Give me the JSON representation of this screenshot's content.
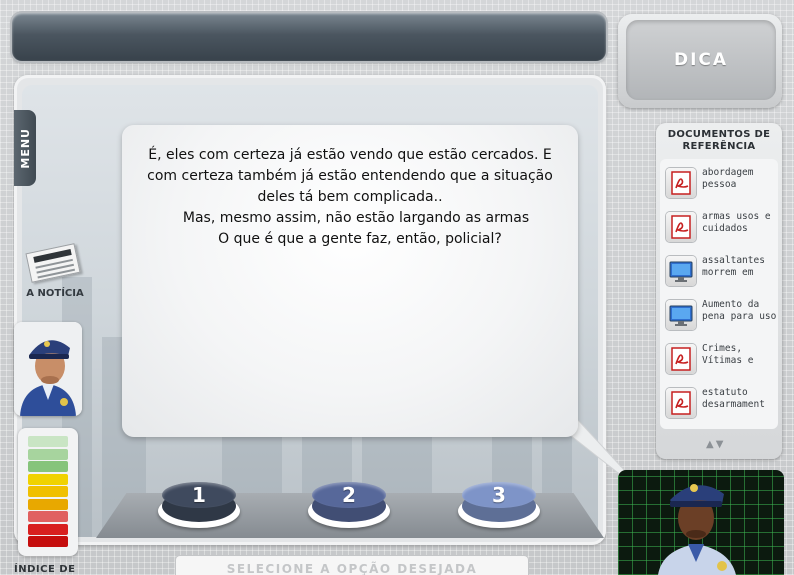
{
  "dica": {
    "label": "DICA"
  },
  "menu": {
    "label": "MENU"
  },
  "noticia": {
    "label": "A NOTÍCIA"
  },
  "indice": {
    "label": "ÍNDICE DE"
  },
  "dialogue": {
    "lines": [
      "É, eles com certeza já estão vendo que estão cercados. E",
      "com certeza também já estão entendendo que a situação",
      "deles tá bem complicada..",
      "Mas, mesmo assim, não estão largando as armas",
      "O que é que a gente faz, então, policial?"
    ]
  },
  "options": [
    {
      "label": "1",
      "color": "#3f4a5e"
    },
    {
      "label": "2",
      "color": "#57689a"
    },
    {
      "label": "3",
      "color": "#7e94c8"
    }
  ],
  "select_prompt": "SELECIONE A OPÇÃO DESEJADA",
  "docs": {
    "title_line1": "DOCUMENTOS DE",
    "title_line2": "REFERÊNCIA",
    "items": [
      {
        "label_line1": "abordagem",
        "label_line2": "pessoa",
        "icon": "pdf-icon"
      },
      {
        "label_line1": "armas usos e",
        "label_line2": "cuidados",
        "icon": "pdf-icon"
      },
      {
        "label_line1": "assaltantes",
        "label_line2": "morrem em",
        "icon": "monitor-icon"
      },
      {
        "label_line1": "Aumento da",
        "label_line2": "pena para uso",
        "icon": "monitor-icon"
      },
      {
        "label_line1": "Crimes,",
        "label_line2": "Vítimas e",
        "icon": "pdf-icon"
      },
      {
        "label_line1": "estatuto",
        "label_line2": "desarmament",
        "icon": "pdf-icon"
      }
    ],
    "scroll_arrows": "▲▼"
  },
  "meter": {
    "colors": [
      "#c9e5c4",
      "#a7d49e",
      "#86c47b",
      "#f0d200",
      "#f0c000",
      "#e8a800",
      "#e06060",
      "#d81f1f",
      "#c50d0d"
    ]
  }
}
